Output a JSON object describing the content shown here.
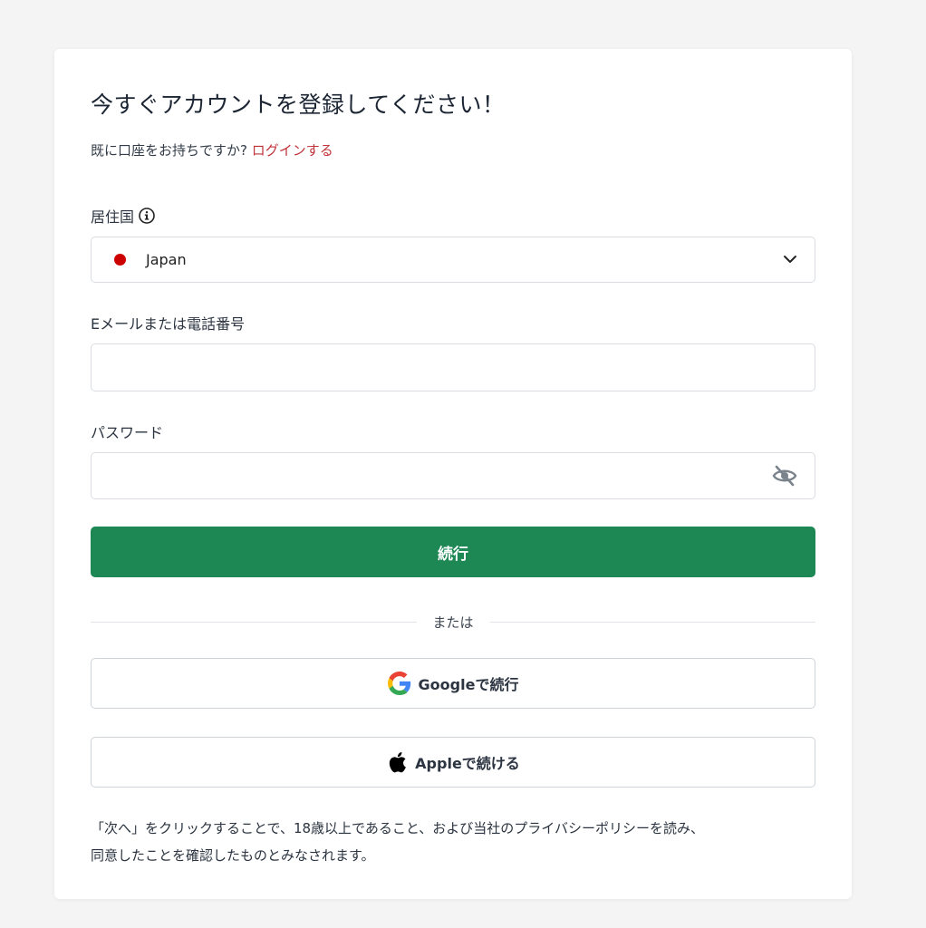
{
  "form": {
    "title": "今すぐアカウントを登録してください！",
    "subtitle_text": "既に口座をお持ちですか?",
    "login_link": "ログインする",
    "country": {
      "label": "居住国",
      "selected": "Japan",
      "flag_color": "#cc0000"
    },
    "email": {
      "label": "Eメールまたは電話番号",
      "value": ""
    },
    "password": {
      "label": "パスワード",
      "value": ""
    },
    "continue_label": "続行",
    "divider_text": "または",
    "google_label": "Googleで続行",
    "apple_label": "Appleで続ける",
    "terms_line1": "「次へ」をクリックすることで、18歳以上であること、および当社のプライバシーポリシーを読み、",
    "terms_line2": "同意したことを確認したものとみなされます。"
  },
  "colors": {
    "accent_green": "#1d8854",
    "link_red": "#c0343a",
    "background": "#f4f4f4"
  },
  "icons": [
    "info-icon",
    "chevron-down-icon",
    "eye-off-icon",
    "google-icon",
    "apple-icon"
  ]
}
